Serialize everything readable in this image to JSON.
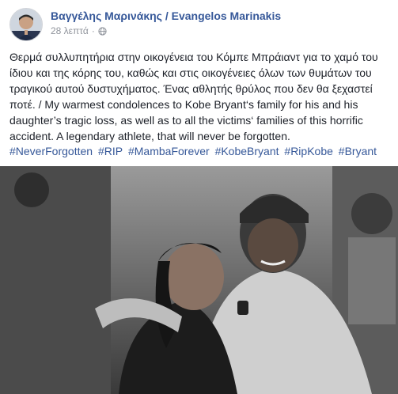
{
  "post": {
    "author": "Βαγγέλης Μαρινάκης / Evangelos Marinakis",
    "time": "28 λεπτά",
    "separator": "·",
    "text": "Θερμά συλλυπητήρια στην οικογένεια του Κόμπε Μπράιαντ για το χαμό του ίδιου και της κόρης του, καθώς και στις οικογένειες όλων των θυμάτων του τραγικού αυτού δυστυχήματος. Ένας αθλητής θρύλος που δεν θα ξεχαστεί ποτέ. / My warmest condolences to Kobe Bryant‘s family for his and his daughter’s tragic loss, as well as to all the victims‘ families of this horrific accident. A legendary athlete, that will never be forgotten.",
    "hashtags": [
      "#NeverForgotten",
      "#RIP",
      "#MambaForever",
      "#KobeBryant",
      "#RipKobe",
      "#Bryant"
    ],
    "audience_icon": "globe-icon",
    "link_color": "#365899"
  }
}
